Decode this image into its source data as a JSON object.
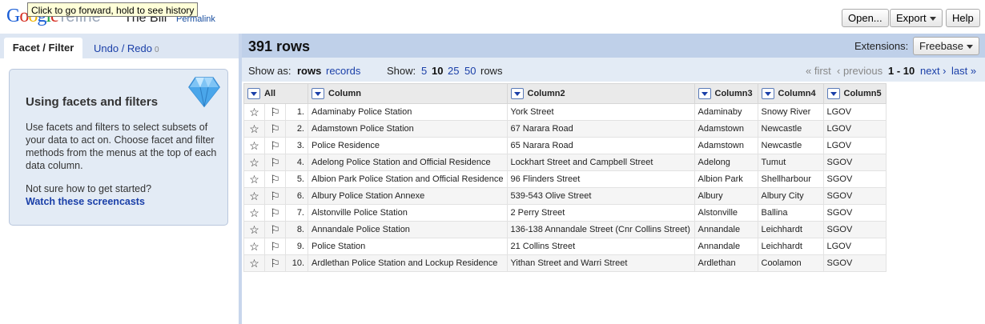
{
  "tooltip": "Click to go forward, hold to see history",
  "header": {
    "logo_letters": [
      "G",
      "o",
      "o",
      "g",
      "l",
      "e"
    ],
    "logo_suffix": "refine",
    "project_name": "The Bill",
    "permalink": "Permalink",
    "buttons": {
      "open": "Open...",
      "export": "Export",
      "help": "Help"
    }
  },
  "left_panel": {
    "tabs": {
      "facet": "Facet / Filter",
      "undo": "Undo / Redo",
      "undo_count": "0"
    },
    "help": {
      "title": "Using facets and filters",
      "text": "Use facets and filters to select subsets of your data to act on. Choose facet and filter methods from the menus at the top of each data column.",
      "question": "Not sure how to get started?",
      "link": "Watch these screencasts"
    }
  },
  "summary": {
    "row_count": "391 rows",
    "extensions_label": "Extensions:",
    "extensions_value": "Freebase"
  },
  "view_bar": {
    "show_as_label": "Show as:",
    "rows": "rows",
    "records": "records",
    "show_label": "Show:",
    "page_sizes": [
      "5",
      "10",
      "25",
      "50"
    ],
    "page_size_suffix": "rows",
    "first": "« first",
    "previous": "‹ previous",
    "range": "1 - 10",
    "next": "next ›",
    "last": "last »"
  },
  "table": {
    "columns": [
      "All",
      "Column",
      "Column2",
      "Column3",
      "Column4",
      "Column5"
    ],
    "rows": [
      [
        "1.",
        "Adaminaby Police Station",
        "York Street",
        "Adaminaby",
        "Snowy River",
        "LGOV"
      ],
      [
        "2.",
        "Adamstown Police Station",
        "67 Narara Road",
        "Adamstown",
        "Newcastle",
        "LGOV"
      ],
      [
        "3.",
        "Police Residence",
        "65 Narara Road",
        "Adamstown",
        "Newcastle",
        "LGOV"
      ],
      [
        "4.",
        "Adelong Police Station and Official Residence",
        "Lockhart Street and Campbell Street",
        "Adelong",
        "Tumut",
        "SGOV"
      ],
      [
        "5.",
        "Albion Park Police Station and Official Residence",
        "96 Flinders Street",
        "Albion Park",
        "Shellharbour",
        "SGOV"
      ],
      [
        "6.",
        "Albury Police Station Annexe",
        "539-543 Olive Street",
        "Albury",
        "Albury City",
        "SGOV"
      ],
      [
        "7.",
        "Alstonville Police Station",
        "2 Perry Street",
        "Alstonville",
        "Ballina",
        "SGOV"
      ],
      [
        "8.",
        "Annandale Police Station",
        "136-138 Annandale Street (Cnr Collins Street)",
        "Annandale",
        "Leichhardt",
        "SGOV"
      ],
      [
        "9.",
        "Police Station",
        "21 Collins Street",
        "Annandale",
        "Leichhardt",
        "LGOV"
      ],
      [
        "10.",
        "Ardlethan Police Station and Lockup Residence",
        "Yithan Street and Warri Street",
        "Ardlethan",
        "Coolamon",
        "SGOV"
      ]
    ]
  }
}
